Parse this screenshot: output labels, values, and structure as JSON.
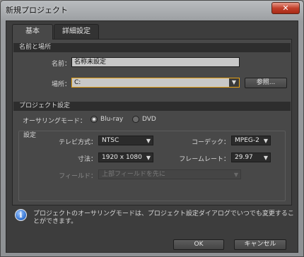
{
  "window": {
    "title": "新規プロジェクト",
    "close_label": "✕"
  },
  "tabs": [
    {
      "label": "基本",
      "active": true
    },
    {
      "label": "詳細設定",
      "active": false
    }
  ],
  "name_location": {
    "header": "名前と場所",
    "name_label": "名前：",
    "name_value": "名称未設定",
    "location_label": "場所：",
    "location_value": "C:",
    "browse_label": "参照..."
  },
  "project_settings": {
    "header": "プロジェクト設定",
    "authoring_mode_label": "オーサリングモード：",
    "modes": [
      {
        "label": "Blu-ray",
        "selected": true
      },
      {
        "label": "DVD",
        "selected": false
      }
    ],
    "settings_group_label": "設定",
    "tv_format_label": "テレビ方式：",
    "tv_format_value": "NTSC",
    "codec_label": "コーデック：",
    "codec_value": "MPEG-2",
    "dimensions_label": "寸法：",
    "dimensions_value": "1920 x 1080",
    "framerate_label": "フレームレート：",
    "framerate_value": "29.97",
    "field_label": "フィールド：",
    "field_value": "上部フィールドを先に"
  },
  "info_message": "プロジェクトのオーサリングモードは、プロジェクト設定ダイアログでいつでも変更することができます。",
  "buttons": {
    "ok": "OK",
    "cancel": "キャンセル"
  },
  "colors": {
    "focus_border": "#e4a013",
    "panel_bg": "#484848",
    "client_bg": "#3d3d3d"
  }
}
